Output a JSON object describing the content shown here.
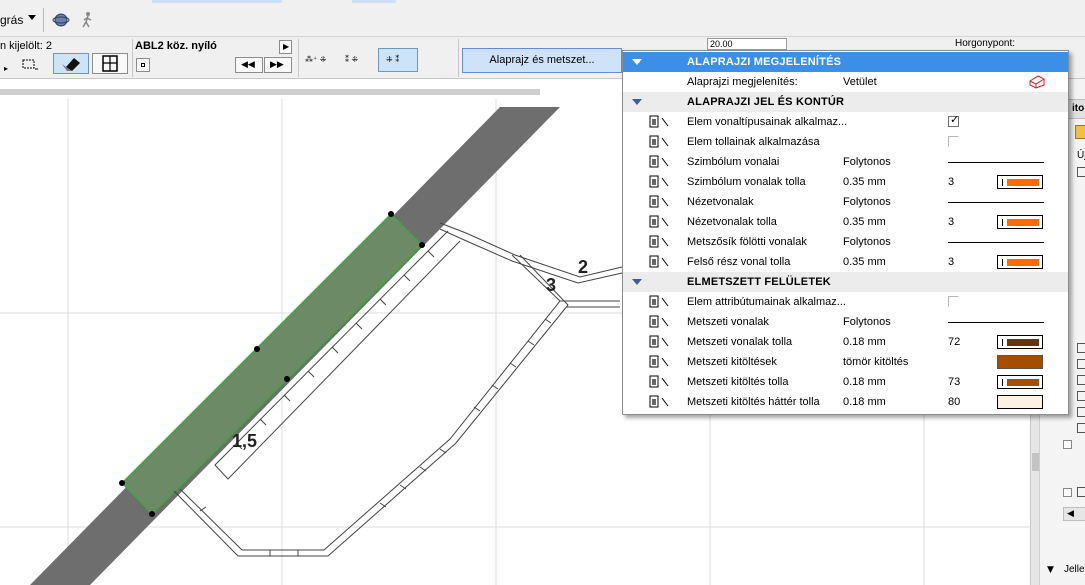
{
  "toolbar": {
    "menu_label": "grás"
  },
  "infobox": {
    "selected_count_label": "n kijelölt: 2",
    "element_name": "ABL2 köz. nyíló",
    "plan_section_button": "Alaprajz és metszet...",
    "value_box": "20.00",
    "anchor_label": "Horgonypont:"
  },
  "canvas": {
    "dim_labels": [
      "2",
      "3",
      "1,5"
    ]
  },
  "navpanel": {
    "tab_label": "ito",
    "list_item_label": "Új",
    "bottom_label": "Jelle"
  },
  "popup": {
    "sections": [
      {
        "title": "ALAPRAJZI MEGJELENÍTÉS",
        "selected": true,
        "rows": [
          {
            "label": "Alaprajzi megjelenítés:",
            "value": "Vetület",
            "kind": "plan-display"
          }
        ]
      },
      {
        "title": "ALAPRAJZI JEL ÉS KONTÚR",
        "rows": [
          {
            "label": "Elem vonaltípusainak alkalmaz...",
            "kind": "checkbox",
            "checked": true
          },
          {
            "label": "Elem tollainak alkalmazása",
            "kind": "checkbox",
            "checked": false
          },
          {
            "label": "Szimbólum vonalai",
            "value": "Folytonos",
            "kind": "line"
          },
          {
            "label": "Szimbólum vonalak tolla",
            "value": "0.35 mm",
            "pen": "3",
            "kind": "pen",
            "color": "#ff6a00"
          },
          {
            "label": "Nézetvonalak",
            "value": "Folytonos",
            "kind": "line"
          },
          {
            "label": "Nézetvonalak tolla",
            "value": "0.35 mm",
            "pen": "3",
            "kind": "pen",
            "color": "#ff6a00"
          },
          {
            "label": "Metszősík fölötti vonalak",
            "value": "Folytonos",
            "kind": "line"
          },
          {
            "label": "Felső rész vonal tolla",
            "value": "0.35 mm",
            "pen": "3",
            "kind": "pen",
            "color": "#ff6a00"
          }
        ]
      },
      {
        "title": "ELMETSZETT FELÜLETEK",
        "rows": [
          {
            "label": "Elem attribútumainak alkalmaz...",
            "kind": "checkbox",
            "checked": false
          },
          {
            "label": "Metszeti vonalak",
            "value": "Folytonos",
            "kind": "line"
          },
          {
            "label": "Metszeti vonalak tolla",
            "value": "0.18 mm",
            "pen": "72",
            "kind": "pen",
            "color": "#6b3200"
          },
          {
            "label": "Metszeti kitöltések",
            "value": "tömör kitöltés",
            "kind": "fill",
            "color": "#a54e00"
          },
          {
            "label": "Metszeti kitöltés tolla",
            "value": "0.18 mm",
            "pen": "73",
            "kind": "pen",
            "color": "#a54e00"
          },
          {
            "label": "Metszeti kitöltés háttér tolla",
            "value": "0.18 mm",
            "pen": "80",
            "kind": "pen-blank",
            "color": "#fdf1e4"
          }
        ]
      }
    ]
  }
}
